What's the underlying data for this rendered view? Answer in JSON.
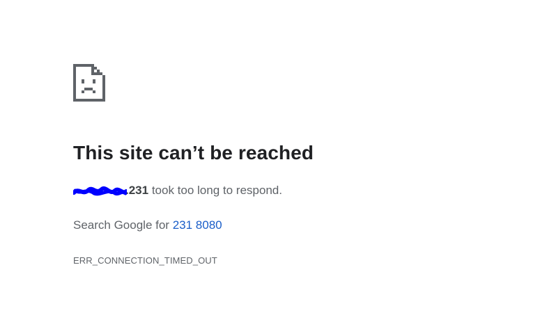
{
  "error_page": {
    "title": "This site can’t be reached",
    "host_suffix": ".231",
    "respond_text": " took too long to respond.",
    "search_prefix": "Search Google for ",
    "search_query": "231 8080",
    "error_code": "ERR_CONNECTION_TIMED_OUT",
    "icon": "sad-page-icon",
    "redaction_color": "#0000ff"
  }
}
